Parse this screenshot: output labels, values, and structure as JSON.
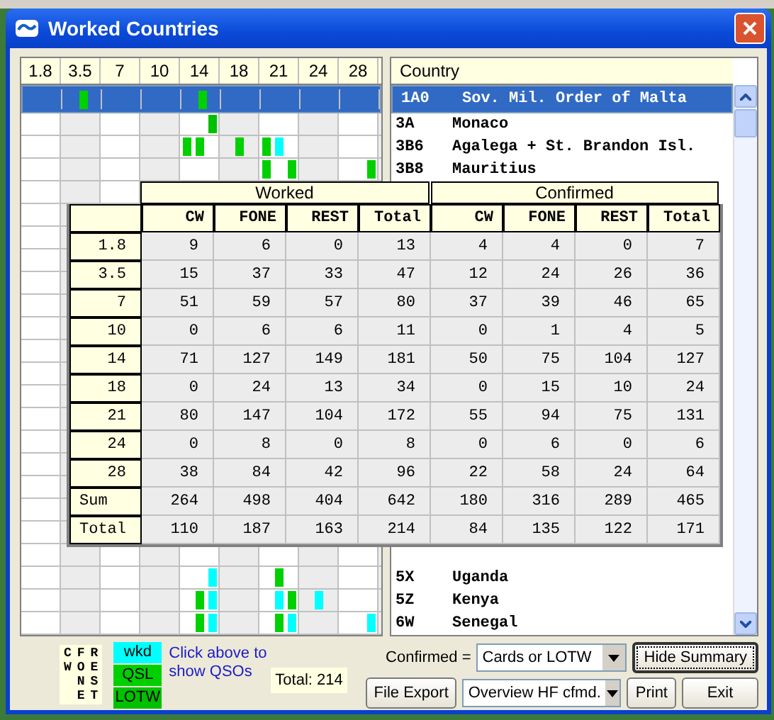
{
  "window": {
    "title": "Worked Countries"
  },
  "bands": [
    "1.8",
    "3.5",
    "7",
    "10",
    "14",
    "18",
    "21",
    "24",
    "28"
  ],
  "country_header": "Country",
  "top_rows": [
    {
      "prefix": "1A0",
      "country": "Sov. Mil. Order of Malta",
      "selected": true,
      "marks": [
        [
          {
            "kind": "none"
          },
          {
            "kind": "none"
          },
          {
            "kind": "none"
          }
        ],
        [
          {
            "kind": "none"
          },
          {
            "kind": "qsl"
          },
          {
            "kind": "none"
          }
        ],
        [
          {
            "kind": "none"
          },
          {
            "kind": "none"
          },
          {
            "kind": "none"
          }
        ],
        [
          {
            "kind": "none"
          },
          {
            "kind": "none"
          },
          {
            "kind": "none"
          }
        ],
        [
          {
            "kind": "none"
          },
          {
            "kind": "qsl"
          },
          {
            "kind": "none"
          }
        ],
        [
          {
            "kind": "none"
          },
          {
            "kind": "none"
          },
          {
            "kind": "none"
          }
        ],
        [
          {
            "kind": "none"
          },
          {
            "kind": "none"
          },
          {
            "kind": "none"
          }
        ],
        [
          {
            "kind": "none"
          },
          {
            "kind": "none"
          },
          {
            "kind": "none"
          }
        ],
        [
          {
            "kind": "none"
          },
          {
            "kind": "none"
          },
          {
            "kind": "none"
          }
        ]
      ]
    },
    {
      "prefix": "3A",
      "country": "Monaco",
      "selected": false,
      "marks": [
        [
          {
            "kind": "none"
          },
          {
            "kind": "none"
          },
          {
            "kind": "none"
          }
        ],
        [
          {
            "kind": "none"
          },
          {
            "kind": "none"
          },
          {
            "kind": "none"
          }
        ],
        [
          {
            "kind": "none"
          },
          {
            "kind": "none"
          },
          {
            "kind": "none"
          }
        ],
        [
          {
            "kind": "none"
          },
          {
            "kind": "none"
          },
          {
            "kind": "none"
          }
        ],
        [
          {
            "kind": "none"
          },
          {
            "kind": "none"
          },
          {
            "kind": "lotw"
          }
        ],
        [
          {
            "kind": "none"
          },
          {
            "kind": "none"
          },
          {
            "kind": "none"
          }
        ],
        [
          {
            "kind": "none"
          },
          {
            "kind": "none"
          },
          {
            "kind": "none"
          }
        ],
        [
          {
            "kind": "none"
          },
          {
            "kind": "none"
          },
          {
            "kind": "none"
          }
        ],
        [
          {
            "kind": "none"
          },
          {
            "kind": "none"
          },
          {
            "kind": "none"
          }
        ]
      ]
    },
    {
      "prefix": "3B6",
      "country": "Agalega + St. Brandon Isl.",
      "selected": false,
      "marks": [
        [
          {
            "kind": "none"
          },
          {
            "kind": "none"
          },
          {
            "kind": "none"
          }
        ],
        [
          {
            "kind": "none"
          },
          {
            "kind": "none"
          },
          {
            "kind": "none"
          }
        ],
        [
          {
            "kind": "none"
          },
          {
            "kind": "none"
          },
          {
            "kind": "none"
          }
        ],
        [
          {
            "kind": "none"
          },
          {
            "kind": "none"
          },
          {
            "kind": "none"
          }
        ],
        [
          {
            "kind": "qsl"
          },
          {
            "kind": "qsl"
          },
          {
            "kind": "none"
          }
        ],
        [
          {
            "kind": "none"
          },
          {
            "kind": "qsl"
          },
          {
            "kind": "none"
          }
        ],
        [
          {
            "kind": "qsl"
          },
          {
            "kind": "wkd"
          },
          {
            "kind": "none"
          }
        ],
        [
          {
            "kind": "none"
          },
          {
            "kind": "none"
          },
          {
            "kind": "none"
          }
        ],
        [
          {
            "kind": "none"
          },
          {
            "kind": "none"
          },
          {
            "kind": "none"
          }
        ]
      ]
    },
    {
      "prefix": "3B8",
      "country": "Mauritius",
      "selected": false,
      "marks": [
        [
          {
            "kind": "none"
          },
          {
            "kind": "none"
          },
          {
            "kind": "none"
          }
        ],
        [
          {
            "kind": "none"
          },
          {
            "kind": "none"
          },
          {
            "kind": "none"
          }
        ],
        [
          {
            "kind": "none"
          },
          {
            "kind": "none"
          },
          {
            "kind": "none"
          }
        ],
        [
          {
            "kind": "none"
          },
          {
            "kind": "none"
          },
          {
            "kind": "none"
          }
        ],
        [
          {
            "kind": "none"
          },
          {
            "kind": "none"
          },
          {
            "kind": "none"
          }
        ],
        [
          {
            "kind": "none"
          },
          {
            "kind": "none"
          },
          {
            "kind": "none"
          }
        ],
        [
          {
            "kind": "qsl"
          },
          {
            "kind": "none"
          },
          {
            "kind": "qsl"
          }
        ],
        [
          {
            "kind": "none"
          },
          {
            "kind": "none"
          },
          {
            "kind": "none"
          }
        ],
        [
          {
            "kind": "none"
          },
          {
            "kind": "none"
          },
          {
            "kind": "qsl"
          }
        ]
      ]
    }
  ],
  "bottom_rows": [
    {
      "prefix": "5X",
      "country": "Uganda",
      "selected": false,
      "marks": [
        [
          {
            "kind": "none"
          },
          {
            "kind": "none"
          },
          {
            "kind": "none"
          }
        ],
        [
          {
            "kind": "none"
          },
          {
            "kind": "none"
          },
          {
            "kind": "none"
          }
        ],
        [
          {
            "kind": "none"
          },
          {
            "kind": "none"
          },
          {
            "kind": "none"
          }
        ],
        [
          {
            "kind": "none"
          },
          {
            "kind": "none"
          },
          {
            "kind": "none"
          }
        ],
        [
          {
            "kind": "none"
          },
          {
            "kind": "none"
          },
          {
            "kind": "wkd"
          }
        ],
        [
          {
            "kind": "none"
          },
          {
            "kind": "none"
          },
          {
            "kind": "none"
          }
        ],
        [
          {
            "kind": "none"
          },
          {
            "kind": "qsl"
          },
          {
            "kind": "none"
          }
        ],
        [
          {
            "kind": "none"
          },
          {
            "kind": "none"
          },
          {
            "kind": "none"
          }
        ],
        [
          {
            "kind": "none"
          },
          {
            "kind": "none"
          },
          {
            "kind": "none"
          }
        ]
      ]
    },
    {
      "prefix": "5Z",
      "country": "Kenya",
      "selected": false,
      "marks": [
        [
          {
            "kind": "none"
          },
          {
            "kind": "none"
          },
          {
            "kind": "none"
          }
        ],
        [
          {
            "kind": "none"
          },
          {
            "kind": "none"
          },
          {
            "kind": "none"
          }
        ],
        [
          {
            "kind": "none"
          },
          {
            "kind": "none"
          },
          {
            "kind": "none"
          }
        ],
        [
          {
            "kind": "none"
          },
          {
            "kind": "none"
          },
          {
            "kind": "none"
          }
        ],
        [
          {
            "kind": "none"
          },
          {
            "kind": "qsl"
          },
          {
            "kind": "wkd"
          }
        ],
        [
          {
            "kind": "none"
          },
          {
            "kind": "none"
          },
          {
            "kind": "none"
          }
        ],
        [
          {
            "kind": "none"
          },
          {
            "kind": "wkd"
          },
          {
            "kind": "qsl"
          }
        ],
        [
          {
            "kind": "none"
          },
          {
            "kind": "wkd"
          },
          {
            "kind": "none"
          }
        ],
        [
          {
            "kind": "none"
          },
          {
            "kind": "none"
          },
          {
            "kind": "none"
          }
        ]
      ]
    },
    {
      "prefix": "6W",
      "country": "Senegal",
      "selected": false,
      "marks": [
        [
          {
            "kind": "none"
          },
          {
            "kind": "none"
          },
          {
            "kind": "none"
          }
        ],
        [
          {
            "kind": "none"
          },
          {
            "kind": "none"
          },
          {
            "kind": "none"
          }
        ],
        [
          {
            "kind": "none"
          },
          {
            "kind": "none"
          },
          {
            "kind": "none"
          }
        ],
        [
          {
            "kind": "none"
          },
          {
            "kind": "none"
          },
          {
            "kind": "none"
          }
        ],
        [
          {
            "kind": "none"
          },
          {
            "kind": "qsl"
          },
          {
            "kind": "wkd"
          }
        ],
        [
          {
            "kind": "none"
          },
          {
            "kind": "none"
          },
          {
            "kind": "none"
          }
        ],
        [
          {
            "kind": "none"
          },
          {
            "kind": "qsl"
          },
          {
            "kind": "wkd"
          }
        ],
        [
          {
            "kind": "none"
          },
          {
            "kind": "none"
          },
          {
            "kind": "none"
          }
        ],
        [
          {
            "kind": "none"
          },
          {
            "kind": "none"
          },
          {
            "kind": "wkd"
          }
        ]
      ]
    }
  ],
  "summary": {
    "groups": [
      "Worked",
      "Confirmed"
    ],
    "columns": [
      "CW",
      "FONE",
      "REST",
      "Total",
      "CW",
      "FONE",
      "REST",
      "Total"
    ],
    "rows": [
      {
        "label": "1.8",
        "kind": "band",
        "values": [
          "9",
          "6",
          "0",
          "13",
          "4",
          "4",
          "0",
          "7"
        ]
      },
      {
        "label": "3.5",
        "kind": "band",
        "values": [
          "15",
          "37",
          "33",
          "47",
          "12",
          "24",
          "26",
          "36"
        ]
      },
      {
        "label": "7",
        "kind": "band",
        "values": [
          "51",
          "59",
          "57",
          "80",
          "37",
          "39",
          "46",
          "65"
        ]
      },
      {
        "label": "10",
        "kind": "band",
        "values": [
          "0",
          "6",
          "6",
          "11",
          "0",
          "1",
          "4",
          "5"
        ]
      },
      {
        "label": "14",
        "kind": "band",
        "values": [
          "71",
          "127",
          "149",
          "181",
          "50",
          "75",
          "104",
          "127"
        ]
      },
      {
        "label": "18",
        "kind": "band",
        "values": [
          "0",
          "24",
          "13",
          "34",
          "0",
          "15",
          "10",
          "24"
        ]
      },
      {
        "label": "21",
        "kind": "band",
        "values": [
          "80",
          "147",
          "104",
          "172",
          "55",
          "94",
          "75",
          "131"
        ]
      },
      {
        "label": "24",
        "kind": "band",
        "values": [
          "0",
          "8",
          "0",
          "8",
          "0",
          "6",
          "0",
          "6"
        ]
      },
      {
        "label": "28",
        "kind": "band",
        "values": [
          "38",
          "84",
          "42",
          "96",
          "22",
          "58",
          "24",
          "64"
        ]
      },
      {
        "label": "Sum",
        "kind": "total",
        "values": [
          "264",
          "498",
          "404",
          "642",
          "180",
          "316",
          "289",
          "465"
        ]
      },
      {
        "label": "Total",
        "kind": "total",
        "values": [
          "110",
          "187",
          "163",
          "214",
          "84",
          "135",
          "122",
          "171"
        ]
      }
    ]
  },
  "legend_modes": [
    "CW",
    "FONE",
    "REST"
  ],
  "legend_status": [
    {
      "label": "wkd",
      "kind": "wkd"
    },
    {
      "label": "QSL",
      "kind": "qsl"
    },
    {
      "label": "LOTW",
      "kind": "lotw"
    }
  ],
  "hint": "Click above to show QSOs",
  "total": "Total: 214",
  "confirmed_label": "Confirmed =",
  "confirmed_select": "Cards or LOTW",
  "hide_summary_button": "Hide Summary",
  "file_export_button": "File Export",
  "export_select": "Overview HF cfmd.",
  "print_button": "Print",
  "exit_button": "Exit"
}
